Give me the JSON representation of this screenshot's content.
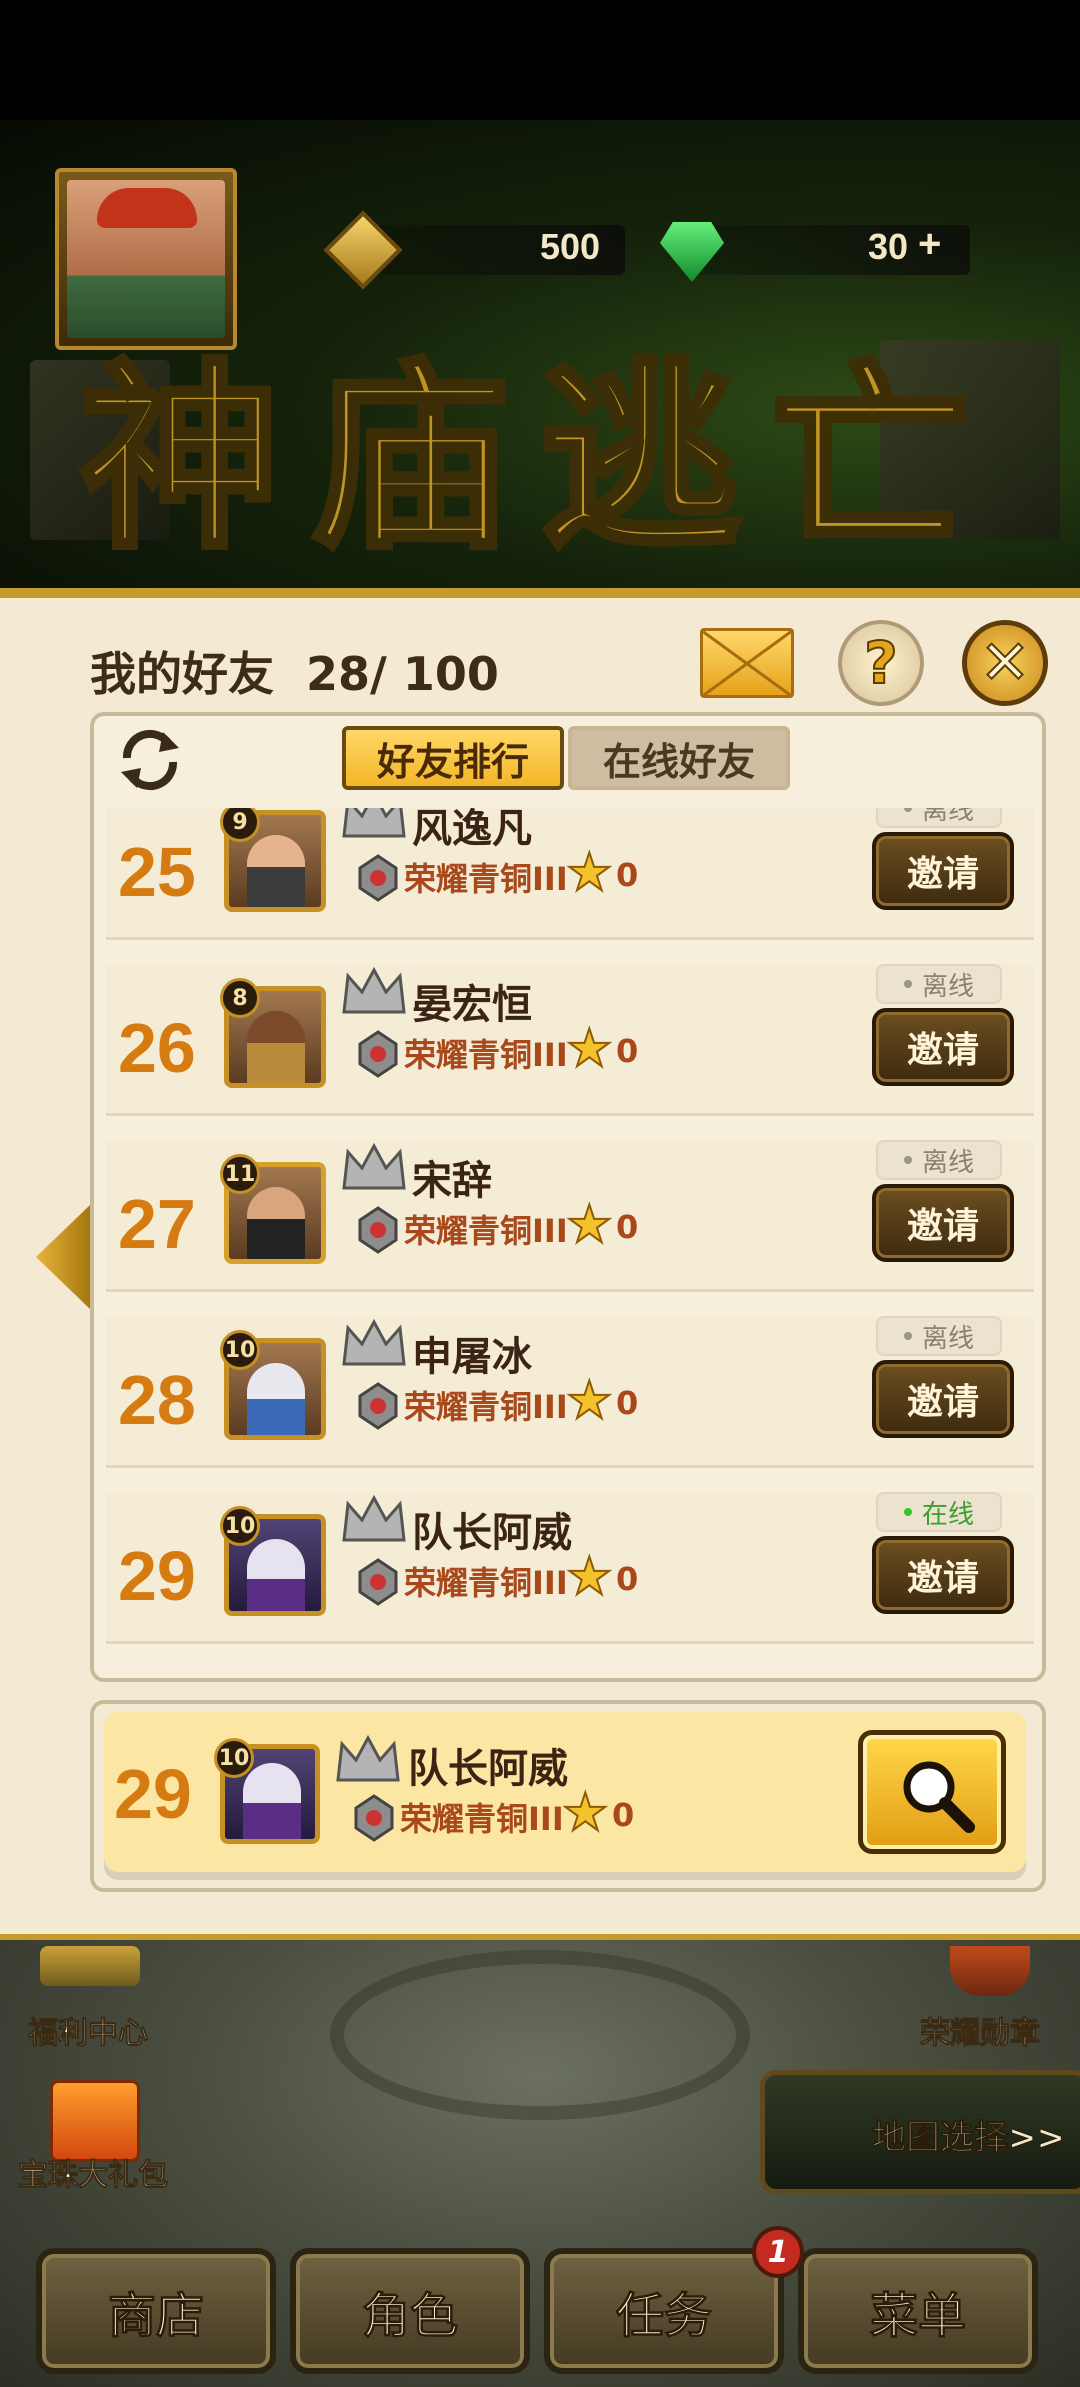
{
  "currencies": {
    "gold": "500",
    "gems": "30",
    "add_symbol": "+"
  },
  "game_title": "神庙逃亡",
  "dialog": {
    "title": "我的好友",
    "count": "28/ 100",
    "tabs": [
      {
        "label": "好友排行",
        "active": true
      },
      {
        "label": "在线好友",
        "active": false
      }
    ]
  },
  "friends": [
    {
      "rank": "25",
      "level": "9",
      "name": "风逸凡",
      "tier": "荣耀青铜III",
      "stars": "0",
      "status": "离线",
      "online": false,
      "invite": "邀请"
    },
    {
      "rank": "26",
      "level": "8",
      "name": "晏宏恒",
      "tier": "荣耀青铜III",
      "stars": "0",
      "status": "离线",
      "online": false,
      "invite": "邀请"
    },
    {
      "rank": "27",
      "level": "11",
      "name": "宋辞",
      "tier": "荣耀青铜III",
      "stars": "0",
      "status": "离线",
      "online": false,
      "invite": "邀请"
    },
    {
      "rank": "28",
      "level": "10",
      "name": "申屠冰",
      "tier": "荣耀青铜III",
      "stars": "0",
      "status": "离线",
      "online": false,
      "invite": "邀请"
    },
    {
      "rank": "29",
      "level": "10",
      "name": "队长阿威",
      "tier": "荣耀青铜III",
      "stars": "0",
      "status": "在线",
      "online": true,
      "invite": "邀请"
    }
  ],
  "me": {
    "rank": "29",
    "level": "10",
    "name": "队长阿威",
    "tier": "荣耀青铜III",
    "stars": "0"
  },
  "side_labels": {
    "welfare": "福利中心",
    "gift": "宝珠大礼包",
    "honor": "荣耀勋章",
    "map": "地图选择>>"
  },
  "nav": [
    {
      "label": "商店"
    },
    {
      "label": "角色"
    },
    {
      "label": "任务"
    },
    {
      "label": "菜单"
    }
  ],
  "task_badge": "1"
}
